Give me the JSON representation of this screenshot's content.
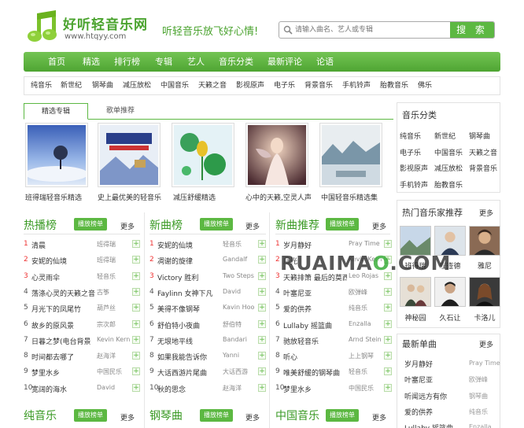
{
  "header": {
    "site_name": "好听轻音乐网",
    "site_url": "www.htqyy.com",
    "slogan": "听轻音乐放飞好心情!",
    "search_placeholder": "请输入曲名、艺人或专辑",
    "search_button": "搜 索"
  },
  "nav": [
    "首页",
    "精选",
    "排行榜",
    "专辑",
    "艺人",
    "音乐分类",
    "最新评论",
    "论语"
  ],
  "subnav": [
    "纯音乐",
    "新世纪",
    "钢琴曲",
    "减压放松",
    "中国音乐",
    "天籁之音",
    "影视原声",
    "电子乐",
    "背景音乐",
    "手机铃声",
    "胎教音乐",
    "佛乐"
  ],
  "featured": {
    "tabs": [
      "精选专辑",
      "歌单推荐"
    ],
    "albums": [
      "班得瑞轻音乐精选",
      "史上最优美的轻音乐",
      "减压舒缓精选",
      "心中的天籁,空灵人声",
      "中国轻音乐精选集"
    ]
  },
  "columns": [
    {
      "title": "热播榜",
      "play": "播放榜单",
      "more": "更多",
      "songs": [
        [
          "清晨",
          "班得瑞"
        ],
        [
          "安妮的仙境",
          "班得瑞"
        ],
        [
          "心灵雨伞",
          "轻音乐"
        ],
        [
          "荡涤心灵的天籁之音",
          "古筝"
        ],
        [
          "月光下的凤尾竹",
          "葫芦丝"
        ],
        [
          "故乡的原风景",
          "宗次郎"
        ],
        [
          "日暮之梦(电台背景",
          "Kevin Kern"
        ],
        [
          "时间都去哪了",
          "赵海洋"
        ],
        [
          "梦里水乡",
          "中国民乐"
        ],
        [
          "宽阔的海水",
          "David"
        ]
      ]
    },
    {
      "title": "新曲榜",
      "play": "播放榜单",
      "more": "更多",
      "songs": [
        [
          "安妮的仙境",
          "轻音乐"
        ],
        [
          "凋谢的旋律",
          "Gandalf"
        ],
        [
          "Victory 胜利",
          "Two Steps"
        ],
        [
          "Faylinn 女神下凡",
          "David"
        ],
        [
          "美得不像钢琴",
          "Kavin Hoo"
        ],
        [
          "舒伯特小夜曲",
          "舒伯特"
        ],
        [
          "无垠地平线",
          "Bandari"
        ],
        [
          "如果我能告诉你",
          "Yanni"
        ],
        [
          "大话西游片尾曲",
          "大话西游"
        ],
        [
          "秋的思念",
          "赵海洋"
        ]
      ]
    },
    {
      "title": "新曲推荐",
      "play": "播放榜单",
      "more": "更多",
      "songs": [
        [
          "岁月静好",
          "Pray Time"
        ],
        [
          "月光",
          "Kevin Kern"
        ],
        [
          "天籁排箫 最后的莫西",
          "Leo Rojas"
        ],
        [
          "叶塞尼亚",
          "欧弹峰"
        ],
        [
          "爱的供养",
          "纯音乐"
        ],
        [
          "Lullaby 摇篮曲",
          "Enzalla"
        ],
        [
          "驰放轻音乐",
          "Arnd Stein"
        ],
        [
          "听心",
          "上上钢琴"
        ],
        [
          "唯美舒缓的钢琴曲",
          "轻音乐"
        ],
        [
          "梦里水乡",
          "中国民乐"
        ]
      ]
    }
  ],
  "bottom_cols": [
    {
      "title": "纯音乐",
      "play": "播放榜单",
      "more": "更多"
    },
    {
      "title": "钢琴曲",
      "play": "播放榜单",
      "more": "更多"
    },
    {
      "title": "中国音乐",
      "play": "播放榜单",
      "more": "更多"
    }
  ],
  "sidebar": {
    "categories_title": "音乐分类",
    "categories": [
      "纯音乐",
      "新世纪",
      "钢琴曲",
      "电子乐",
      "中国音乐",
      "天籁之音",
      "影视原声",
      "减压放松",
      "背景音乐",
      "手机铃声",
      "胎教音乐"
    ],
    "artists_title": "热门音乐家推荐",
    "artists_more": "更多",
    "artists": [
      "班得瑞",
      "理查德",
      "雅尼",
      "神秘园",
      "久石让",
      "卡洛儿"
    ],
    "new_title": "最新单曲",
    "new_more": "更多",
    "new_songs": [
      [
        "岁月静好",
        "Pray Time"
      ],
      [
        "叶塞尼亚",
        "欧弹峰"
      ],
      [
        "听闻远方有你",
        "钢琴曲"
      ],
      [
        "爱的供养",
        "纯音乐"
      ],
      [
        "Lullaby 摇篮曲",
        "Enzalla"
      ]
    ]
  },
  "watermark": {
    "a": "RUAIMA",
    "b": "O",
    "c": ".COM"
  },
  "colors": {
    "accent": "#5cb842",
    "title_green": "#3a9a24",
    "rank_red": "#e33333"
  }
}
